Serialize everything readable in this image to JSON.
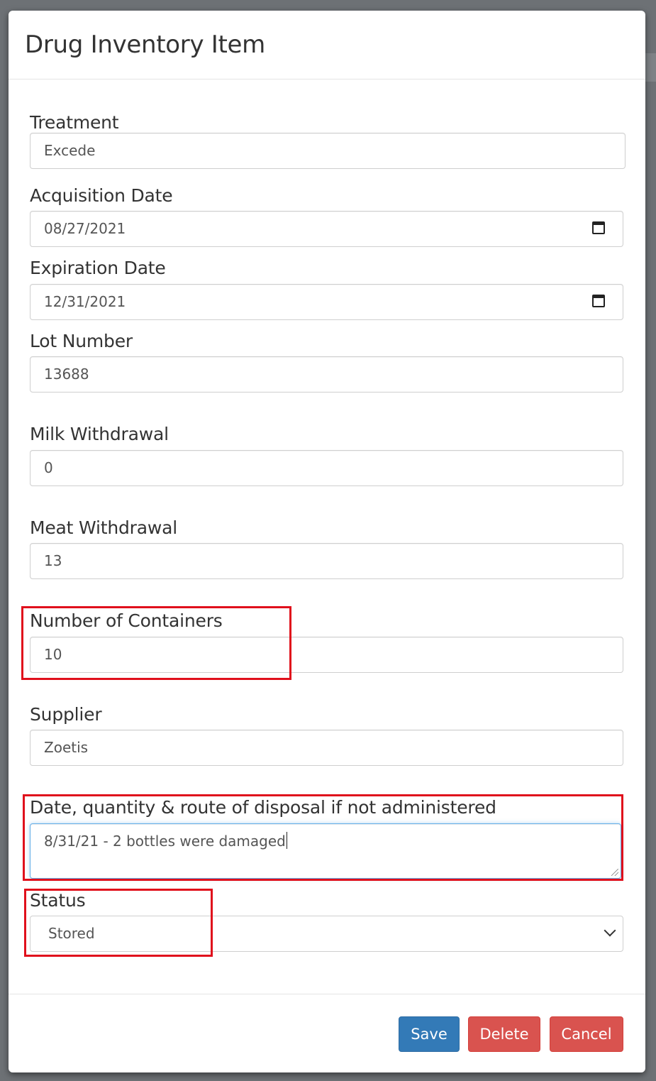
{
  "modal": {
    "title": "Drug Inventory Item"
  },
  "fields": {
    "treatment": {
      "label": "Treatment",
      "value": "Excede"
    },
    "acquisition_date": {
      "label": "Acquisition Date",
      "value": "08/27/2021"
    },
    "expiration_date": {
      "label": "Expiration Date",
      "value": "12/31/2021"
    },
    "lot_number": {
      "label": "Lot Number",
      "value": "13688"
    },
    "milk_withdrawal": {
      "label": "Milk Withdrawal",
      "value": "0"
    },
    "meat_withdrawal": {
      "label": "Meat Withdrawal",
      "value": "13"
    },
    "number_of_containers": {
      "label": "Number of Containers",
      "value": "10"
    },
    "supplier": {
      "label": "Supplier",
      "value": "Zoetis"
    },
    "disposal": {
      "label": "Date, quantity & route of disposal if not administered",
      "value": "8/31/21 - 2 bottles were damaged"
    },
    "status": {
      "label": "Status",
      "value": "Stored"
    }
  },
  "footer": {
    "save_label": "Save",
    "delete_label": "Delete",
    "cancel_label": "Cancel"
  },
  "icons": {
    "date_picker": "calendar-icon",
    "select_arrow": "chevron-down-icon"
  },
  "colors": {
    "primary": "#337ab7",
    "danger": "#d9534f",
    "highlight": "#e0101c"
  }
}
